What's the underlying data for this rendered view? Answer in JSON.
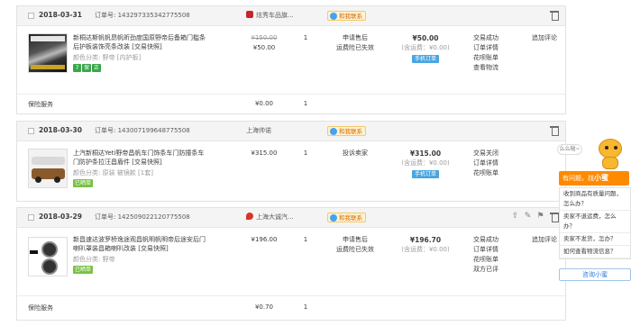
{
  "orders": [
    {
      "date": "2018-03-31",
      "order_label": "订单号:",
      "order_no": "143297335342775508",
      "shop": "炫秀车品旗...",
      "contact": "和我联系",
      "item": {
        "title": "新桐达斯帆帆昂帆昕劲度国原野帝后备箱门槛条后护板装饰亮条改装 [交易快照]",
        "sku": "颜色分类: 野帝 [内护板]",
        "orig_price": "¥150.00",
        "price": "¥50.00",
        "qty": "1",
        "status": [
          "申请售后",
          "运费险已失效"
        ],
        "total": "¥50.00",
        "shipping": "(含运费：¥0.00)",
        "pay_tag": "手机订单",
        "trade": [
          "交易成功",
          "订单详情",
          "花呗账单",
          "查看物流"
        ],
        "action": "追加评论"
      },
      "sub": {
        "label": "保险服务",
        "amount": "¥0.00",
        "qty": "1"
      }
    },
    {
      "date": "2018-03-30",
      "order_label": "订单号:",
      "order_no": "143007199648775508",
      "shop": "上海帅诺",
      "contact": "和我联系",
      "item": {
        "title": "上汽新桐达Yeti野帝昌帆车门饰条车门防撞条车门防护条拉汪昌盾件 [交易快照]",
        "sku": "颜色分类: 原装 被镜款 [1套]",
        "price": "¥315.00",
        "qty": "1",
        "status": [
          "投诉卖家"
        ],
        "total": "¥315.00",
        "shipping": "(含运费：¥0.00)",
        "pay_tag": "手机订单",
        "trade": [
          "交易关闭",
          "订单详情",
          "花呗账单"
        ],
        "action": "",
        "badge": "已晒单"
      }
    },
    {
      "date": "2018-03-29",
      "order_label": "订单号:",
      "order_no": "142509022120775508",
      "shop": "上海大诚汽...",
      "contact": "和我联系",
      "item": {
        "title": "新昌速达波罗桥逸途观昌帆明帆明帝后途安后门喇叭罩装昌箱喇叭改装 [交易快照]",
        "sku": "颜色分类: 野帝",
        "price": "¥196.00",
        "qty": "1",
        "status": [
          "申请售后",
          "运费险已失效"
        ],
        "total": "¥196.70",
        "shipping": "(含运费：¥0.00)",
        "trade": [
          "交易成功",
          "订单详情",
          "花呗账单",
          "双方已评"
        ],
        "action": "追加评论",
        "badge": "已晒单"
      },
      "sub": {
        "label": "保险服务",
        "amount": "¥0.70",
        "qty": "1"
      }
    }
  ],
  "side": {
    "bubble": "么么哒~",
    "ask_prefix": "有问题，找",
    "ask_name": "小蜜",
    "questions": [
      "收到商品有质量问题，怎么办？",
      "卖家不退运费，怎么办？",
      "卖家不发货，怎办？",
      "如何查看物流信息？"
    ],
    "consult": "咨询小蜜"
  },
  "colors": {
    "accent": "#ff8a00",
    "link_blue": "#2f7bd3",
    "tag_blue": "#48a5e0"
  }
}
